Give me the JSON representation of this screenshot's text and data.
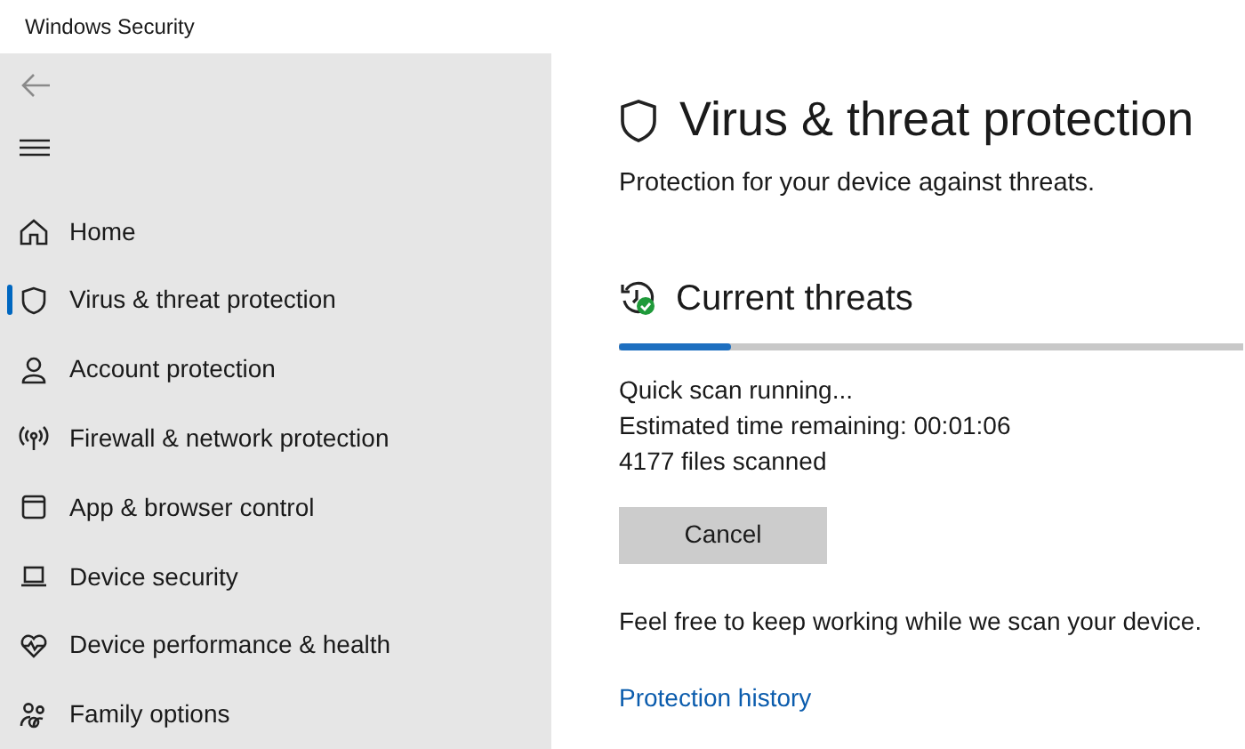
{
  "window": {
    "title": "Windows Security"
  },
  "sidebar": {
    "items": [
      {
        "label": "Home",
        "selected": false
      },
      {
        "label": "Virus & threat protection",
        "selected": true
      },
      {
        "label": "Account protection",
        "selected": false
      },
      {
        "label": "Firewall & network protection",
        "selected": false
      },
      {
        "label": "App & browser control",
        "selected": false
      },
      {
        "label": "Device security",
        "selected": false
      },
      {
        "label": "Device performance & health",
        "selected": false
      },
      {
        "label": "Family options",
        "selected": false
      }
    ]
  },
  "page": {
    "title": "Virus & threat protection",
    "subtitle": "Protection for your device against threats.",
    "section": {
      "title": "Current threats",
      "progress": {
        "level": 0.18
      },
      "status_lines": [
        "Quick scan running...",
        "Estimated time remaining: 00:01:06",
        "4177 files scanned"
      ],
      "button": "Cancel",
      "note": "Feel free to keep working while we scan your device.",
      "link": "Protection history"
    }
  }
}
